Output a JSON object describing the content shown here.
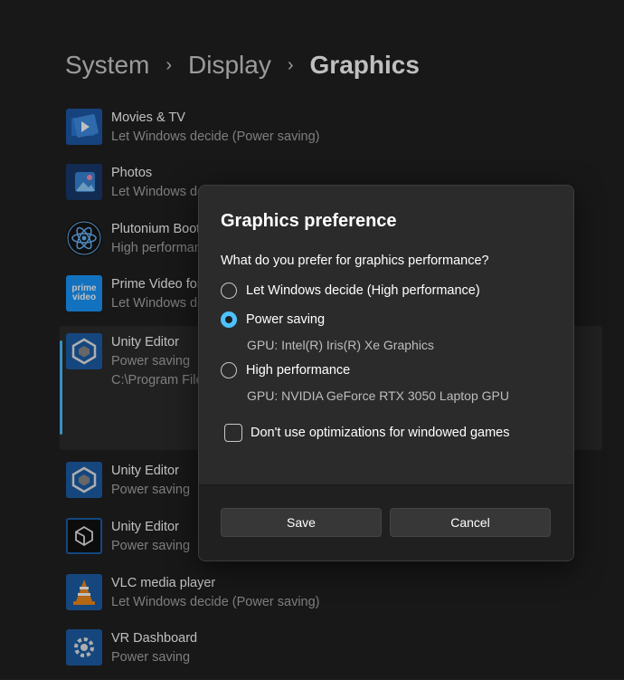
{
  "breadcrumb": {
    "items": [
      "System",
      "Display",
      "Graphics"
    ],
    "separator": "›"
  },
  "apps": [
    {
      "name": "Movies & TV",
      "sub": "Let Windows decide (Power saving)",
      "icon": "movies-tv-icon"
    },
    {
      "name": "Photos",
      "sub": "Let Windows decide (Power saving)",
      "icon": "photos-icon"
    },
    {
      "name": "Plutonium Bootstrapper",
      "sub": "High performance",
      "icon": "plutonium-icon"
    },
    {
      "name": "Prime Video for Windows",
      "sub": "Let Windows decide (Power saving)",
      "icon": "prime-video-icon",
      "icon_text": "prime video"
    },
    {
      "name": "Unity Editor",
      "sub": "Power saving",
      "path": "C:\\Program Files",
      "icon": "unity-icon",
      "selected": true
    },
    {
      "name": "Unity Editor",
      "sub": "Power saving",
      "icon": "unity-icon"
    },
    {
      "name": "Unity Editor",
      "sub": "Power saving",
      "icon": "unity-dark-icon"
    },
    {
      "name": "VLC media player",
      "sub": "Let Windows decide (Power saving)",
      "icon": "vlc-icon"
    },
    {
      "name": "VR Dashboard",
      "sub": "Power saving",
      "icon": "vr-dashboard-icon"
    }
  ],
  "dialog": {
    "title": "Graphics preference",
    "question": "What do you prefer for graphics performance?",
    "options": [
      {
        "label": "Let Windows decide (High performance)",
        "checked": false
      },
      {
        "label": "Power saving",
        "checked": true,
        "gpu": "GPU: Intel(R) Iris(R) Xe Graphics"
      },
      {
        "label": "High performance",
        "checked": false,
        "gpu": "GPU: NVIDIA GeForce RTX 3050 Laptop GPU"
      }
    ],
    "checkbox_label": "Don't use optimizations for windowed games",
    "checkbox_checked": false,
    "save_label": "Save",
    "cancel_label": "Cancel"
  },
  "colors": {
    "accent": "#4cc2ff",
    "background": "#202020",
    "dialog": "#2b2b2b"
  }
}
